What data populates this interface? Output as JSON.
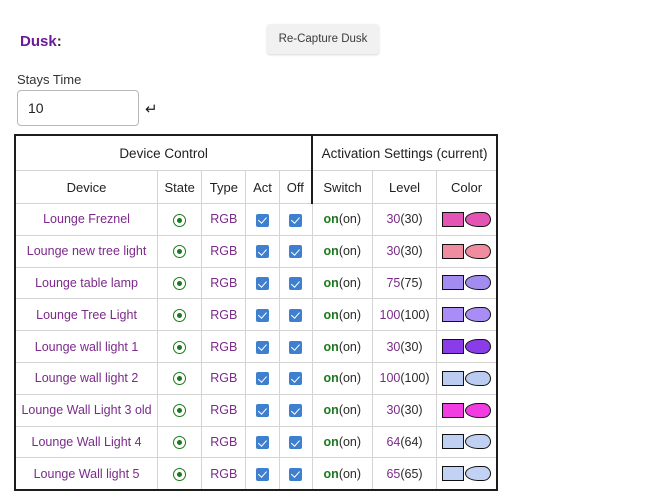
{
  "header": {
    "title_text": "Dusk",
    "title_colon": ":",
    "recapture_label": "Re-Capture Dusk",
    "accent_color": "#6a1b9a"
  },
  "stays": {
    "label": "Stays Time",
    "value": "10",
    "placeholder": "10",
    "enter_icon": "↵"
  },
  "table": {
    "group_headers": [
      {
        "label": "Device Control",
        "span": 5
      },
      {
        "label": "Activation Settings (current)",
        "span": 3
      }
    ],
    "columns": [
      "Device",
      "State",
      "Type",
      "Act",
      "Off",
      "Switch",
      "Level",
      "Color"
    ],
    "rows": [
      {
        "device": "Lounge Freznel",
        "state": "state-on-icon",
        "type": "RGB",
        "act": true,
        "off": true,
        "switch_on": "on",
        "switch_current": "(on)",
        "level": "30",
        "level_current": "(30)",
        "color_a": "#e354b4",
        "color_b": "#e354b4"
      },
      {
        "device": "Lounge new tree light",
        "state": "state-on-icon",
        "type": "RGB",
        "act": true,
        "off": true,
        "switch_on": "on",
        "switch_current": "(on)",
        "level": "30",
        "level_current": "(30)",
        "color_a": "#f08ca0",
        "color_b": "#f08ca0"
      },
      {
        "device": "Lounge table lamp",
        "state": "state-on-icon",
        "type": "RGB",
        "act": true,
        "off": true,
        "switch_on": "on",
        "switch_current": "(on)",
        "level": "75",
        "level_current": "(75)",
        "color_a": "#a38cf0",
        "color_b": "#a38cf0"
      },
      {
        "device": "Lounge Tree Light",
        "state": "state-on-icon",
        "type": "RGB",
        "act": true,
        "off": true,
        "switch_on": "on",
        "switch_current": "(on)",
        "level": "100",
        "level_current": "(100)",
        "color_a": "#a98cf5",
        "color_b": "#a98cf5"
      },
      {
        "device": "Lounge wall light 1",
        "state": "state-on-icon",
        "type": "RGB",
        "act": true,
        "off": true,
        "switch_on": "on",
        "switch_current": "(on)",
        "level": "30",
        "level_current": "(30)",
        "color_a": "#8a3ce8",
        "color_b": "#8a3ce8"
      },
      {
        "device": "Lounge wall light 2",
        "state": "state-on-icon",
        "type": "RGB",
        "act": true,
        "off": true,
        "switch_on": "on",
        "switch_current": "(on)",
        "level": "100",
        "level_current": "(100)",
        "color_a": "#bcccf0",
        "color_b": "#bcccf0"
      },
      {
        "device": "Lounge Wall Light 3 old",
        "state": "state-on-icon",
        "type": "RGB",
        "act": true,
        "off": true,
        "switch_on": "on",
        "switch_current": "(on)",
        "level": "30",
        "level_current": "(30)",
        "color_a": "#f03ce0",
        "color_b": "#f03ce0"
      },
      {
        "device": "Lounge Wall Light 4",
        "state": "state-on-icon",
        "type": "RGB",
        "act": true,
        "off": true,
        "switch_on": "on",
        "switch_current": "(on)",
        "level": "64",
        "level_current": "(64)",
        "color_a": "#bfd0f2",
        "color_b": "#bfd0f2"
      },
      {
        "device": "Lounge Wall light 5",
        "state": "state-on-icon",
        "type": "RGB",
        "act": true,
        "off": true,
        "switch_on": "on",
        "switch_current": "(on)",
        "level": "65",
        "level_current": "(65)",
        "color_a": "#c2d2f4",
        "color_b": "#c2d2f4"
      }
    ]
  }
}
